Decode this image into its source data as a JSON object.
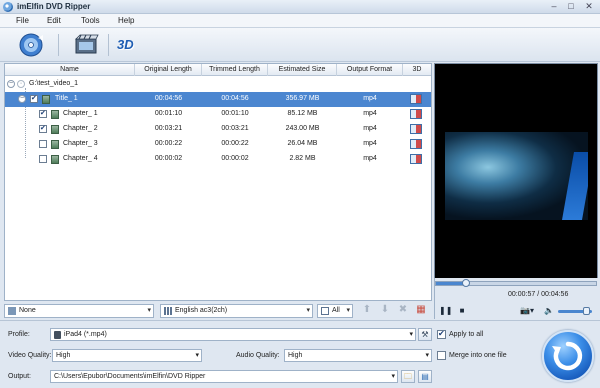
{
  "window": {
    "title": "imElfin DVD Ripper"
  },
  "menu": [
    "File",
    "Edit",
    "Tools",
    "Help"
  ],
  "toolbar": {
    "load_dvd_icon": "dvd-disc-icon",
    "edit_icon": "video-edit-icon",
    "threed_label": "3D"
  },
  "table": {
    "columns": [
      "Name",
      "Original Length",
      "Trimmed Length",
      "Estimated Size",
      "Output Format",
      "3D"
    ],
    "root": "G:\\test_video_1",
    "rows": [
      {
        "name": "Title_ 1",
        "original": "00:04:56",
        "trimmed": "00:04:56",
        "size": "356.97 MB",
        "format": "mp4",
        "checked": true,
        "selected": true
      },
      {
        "name": "Chapter_ 1",
        "original": "00:01:10",
        "trimmed": "00:01:10",
        "size": "85.12 MB",
        "format": "mp4",
        "checked": true,
        "selected": false
      },
      {
        "name": "Chapter_ 2",
        "original": "00:03:21",
        "trimmed": "00:03:21",
        "size": "243.00 MB",
        "format": "mp4",
        "checked": true,
        "selected": false
      },
      {
        "name": "Chapter_ 3",
        "original": "00:00:22",
        "trimmed": "00:00:22",
        "size": "26.04 MB",
        "format": "mp4",
        "checked": false,
        "selected": false
      },
      {
        "name": "Chapter_ 4",
        "original": "00:00:02",
        "trimmed": "00:00:02",
        "size": "2.82 MB",
        "format": "mp4",
        "checked": false,
        "selected": false
      }
    ]
  },
  "controls": {
    "subtitle": "None",
    "audio_track": "English ac3(2ch)",
    "filter": "All"
  },
  "player": {
    "time": "00:00:57 / 00:04:56",
    "progress": 0.19,
    "volume": 0.85
  },
  "settings": {
    "profile_label": "Profile:",
    "profile_value": "iPad4 (*.mp4)",
    "apply_all": "Apply to all",
    "apply_all_checked": true,
    "video_quality_label": "Video Quality:",
    "video_quality": "High",
    "audio_quality_label": "Audio Quality:",
    "audio_quality": "High",
    "merge": "Merge into one file",
    "merge_checked": false,
    "output_label": "Output:",
    "output_path": "C:\\Users\\Epubor\\Documents\\imElfin\\DVD Ripper"
  },
  "colors": {
    "accent": "#4b86d0",
    "background": "#dfe7f1"
  }
}
